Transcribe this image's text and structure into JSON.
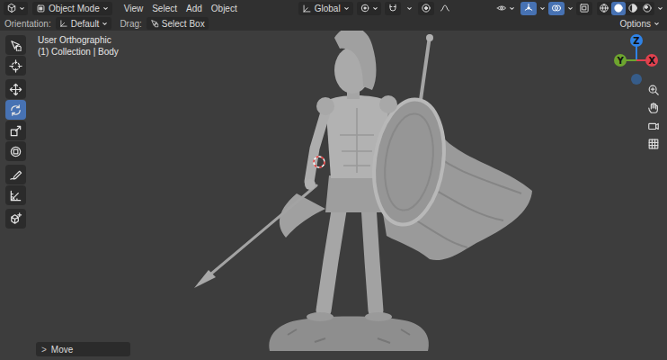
{
  "header": {
    "mode": "Object Mode",
    "menus": [
      "View",
      "Select",
      "Add",
      "Object"
    ],
    "transform_orientation": "Global",
    "snapping_on": false,
    "proportional_editing_on": false,
    "gizmos_on": true,
    "overlays_on": true,
    "xray_on": false,
    "shading": [
      {
        "selected": false
      },
      {
        "selected": true
      },
      {
        "selected": false
      },
      {
        "selected": false
      }
    ]
  },
  "tool_settings": {
    "orientation_label": "Orientation:",
    "orientation": "Default",
    "drag_label": "Drag:",
    "drag": "Select Box",
    "options": "Options"
  },
  "viewport": {
    "view": "User Orthographic",
    "info": "(1) Collection | Body"
  },
  "toolbar": [
    {
      "selected": false
    },
    {
      "selected": false
    },
    {
      "selected": false
    },
    {
      "selected": true
    },
    {
      "selected": false
    },
    {
      "selected": false
    },
    {
      "selected": false
    },
    {
      "selected": false
    },
    {
      "selected": false
    }
  ],
  "gizmo": [
    {
      "label": "Z",
      "color": "#2f83e6"
    },
    {
      "label": "X",
      "color": "#e0414f"
    },
    {
      "label": "Y",
      "color": "#6ea52f"
    }
  ],
  "last_operator": {
    "toggle": ">",
    "label": "Move"
  }
}
